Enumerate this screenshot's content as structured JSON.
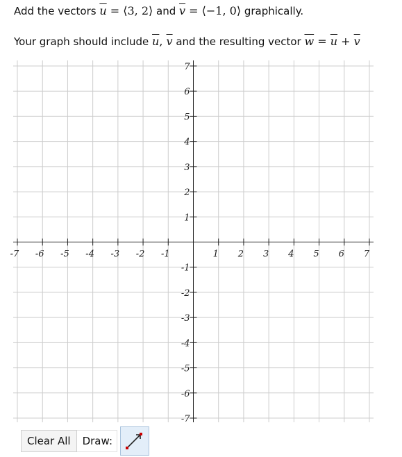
{
  "prompt": {
    "line1": {
      "pre": "Add the vectors ",
      "u_name": "u",
      "u_value": " = ⟨3, 2⟩",
      "mid": " and ",
      "v_name": "v",
      "v_value": " = ⟨−1, 0⟩",
      "post": " graphically."
    },
    "line2": {
      "pre": "Your graph should include ",
      "u_name": "u",
      "comma": ", ",
      "v_name": "v",
      "mid": " and the resulting vector ",
      "w_name": "w",
      "eq": " = ",
      "u2_name": "u",
      "plus": " + ",
      "v2_name": "v"
    }
  },
  "graph": {
    "x_min": -7,
    "x_max": 7,
    "y_min": -7,
    "y_max": 7,
    "x_ticks": [
      "-7",
      "-6",
      "-5",
      "-4",
      "-3",
      "-2",
      "-1",
      "1",
      "2",
      "3",
      "4",
      "5",
      "6",
      "7"
    ],
    "y_ticks": [
      "7",
      "6",
      "5",
      "4",
      "3",
      "2",
      "1",
      "-1",
      "-2",
      "-3",
      "-4",
      "-5",
      "-6",
      "-7"
    ],
    "grid": true,
    "grid_color": "#cccccc",
    "axis_color": "#222222"
  },
  "toolbar": {
    "clear_label": "Clear All",
    "draw_label": "Draw:",
    "vector_tool_icon": "vector-arrow-icon",
    "vector_tool_color": "#cc0000",
    "vector_tool_active_bg": "#e3eef9"
  }
}
